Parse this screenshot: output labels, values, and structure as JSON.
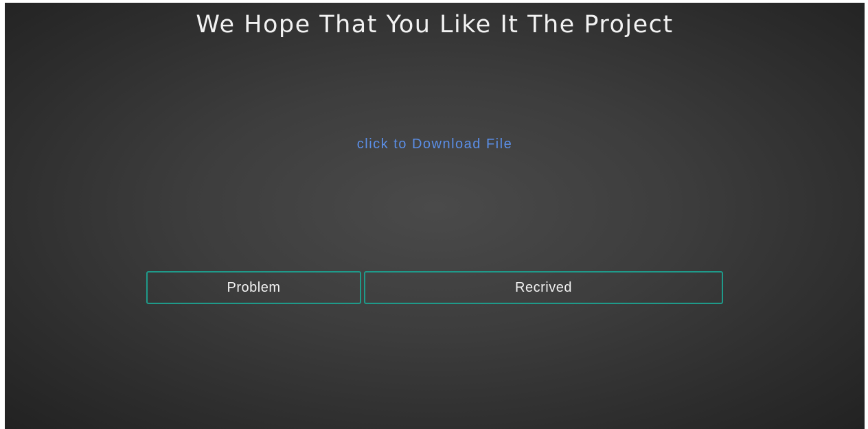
{
  "header": {
    "title": "We Hope That You Like It The Project"
  },
  "main": {
    "download_link": "click to Download File"
  },
  "actions": {
    "problem_label": "Problem",
    "received_label": "Recrived"
  },
  "colors": {
    "title_text": "#f2f2f2",
    "link": "#5b8fe8",
    "button_border": "#1f9a8a",
    "background_center": "#4a4a4a",
    "background_edge": "#222222"
  }
}
